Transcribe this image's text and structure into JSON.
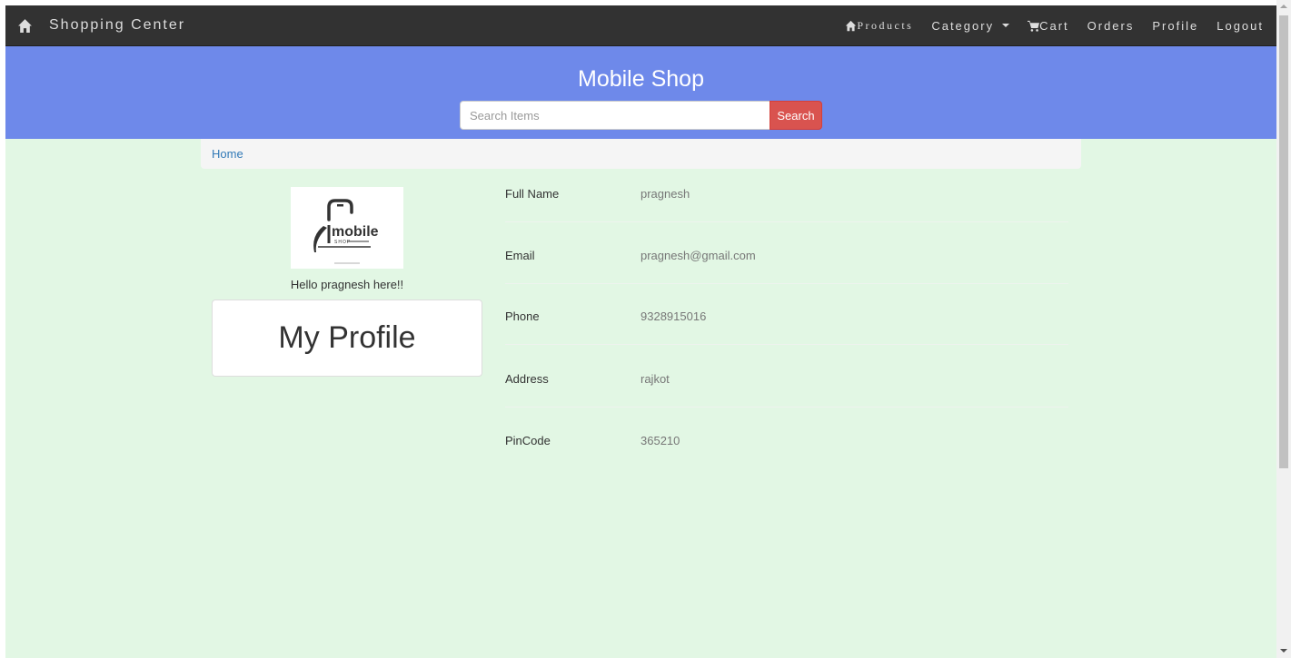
{
  "navbar": {
    "brand": "Shopping Center",
    "links": {
      "products": "Products",
      "category": "Category",
      "cart": "Cart",
      "orders": "Orders",
      "profile": "Profile",
      "logout": "Logout"
    }
  },
  "header": {
    "title": "Mobile Shop",
    "search_placeholder": "Search Items",
    "search_button": "Search"
  },
  "breadcrumb": {
    "home": "Home"
  },
  "profile": {
    "greeting": "Hello pragnesh here!!",
    "card_title": "My Profile",
    "logo": {
      "text": "mobile",
      "subtext": "SHOP"
    }
  },
  "details": {
    "full_name": {
      "label": "Full Name",
      "value": "pragnesh"
    },
    "email": {
      "label": "Email",
      "value": "pragnesh@gmail.com"
    },
    "phone": {
      "label": "Phone",
      "value": "9328915016"
    },
    "address": {
      "label": "Address",
      "value": "rajkot"
    },
    "pincode": {
      "label": "PinCode",
      "value": "365210"
    }
  },
  "colors": {
    "navbar": "#323232",
    "header": "#6e89ea",
    "background": "#e2f7e4",
    "search_button": "#d9534f",
    "link": "#337ab7"
  }
}
